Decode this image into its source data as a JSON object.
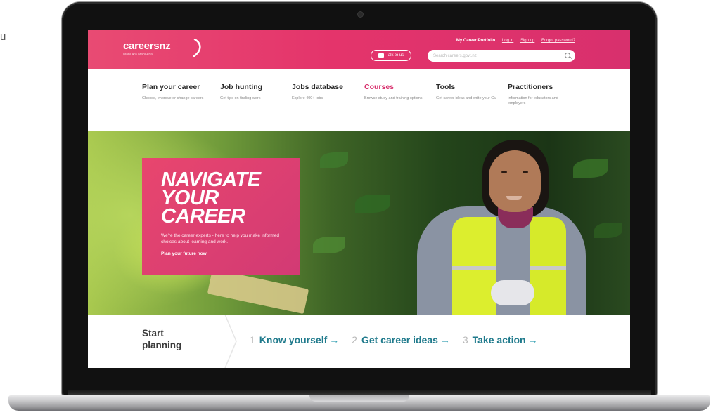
{
  "edge_text": "u",
  "site": {
    "logo_text": "careersnz",
    "logo_tagline": "Mahi Ara Mahi Ana",
    "top_links": {
      "portfolio": "My Career Portfolio",
      "login": "Log in",
      "signup": "Sign up",
      "forgot": "Forgot password?"
    },
    "talk_button": "Talk to us",
    "search_placeholder": "Search careers.govt.nz"
  },
  "nav": [
    {
      "title": "Plan your career",
      "desc": "Choose, improve or change careers"
    },
    {
      "title": "Job hunting",
      "desc": "Get tips on finding work"
    },
    {
      "title": "Jobs database",
      "desc": "Explore 400+ jobs"
    },
    {
      "title": "Courses",
      "desc": "Browse study and training options"
    },
    {
      "title": "Tools",
      "desc": "Get career ideas and write your CV"
    },
    {
      "title": "Practitioners",
      "desc": "Information for educators and employers"
    }
  ],
  "hero": {
    "title": "NAVIGATE YOUR CAREER",
    "text": "We're the career experts - here to help you make informed choices about learning and work.",
    "link": "Plan your future now"
  },
  "plan": {
    "start": "Start planning",
    "steps": [
      {
        "num": "1",
        "label": "Know yourself",
        "arrow": "→"
      },
      {
        "num": "2",
        "label": "Get career ideas",
        "arrow": "→"
      },
      {
        "num": "3",
        "label": "Take action",
        "arrow": "→"
      }
    ]
  },
  "colors": {
    "brand_pink": "#e4346b",
    "active_nav": "#d8306d",
    "step_teal": "#1f7a8c"
  }
}
